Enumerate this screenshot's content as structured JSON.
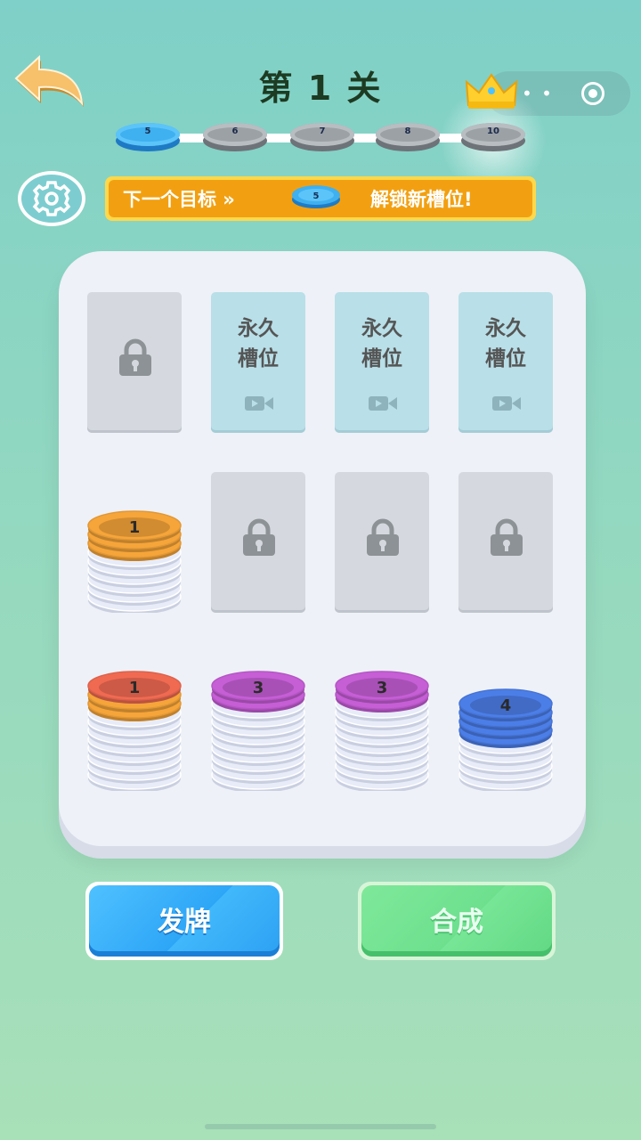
{
  "header": {
    "title": "第 1 关",
    "back_icon": "back-arrow-icon",
    "crown_icon": "crown-icon"
  },
  "progress": {
    "current": "5",
    "nodes": [
      "5",
      "6",
      "7",
      "8",
      "10"
    ]
  },
  "banner": {
    "prefix": "下一个目标 »",
    "coin_value": "5",
    "suffix": "解锁新槽位!"
  },
  "board": {
    "perm_slot_label_line1": "永久",
    "perm_slot_label_line2": "槽位",
    "rows": [
      [
        {
          "type": "locked"
        },
        {
          "type": "perm"
        },
        {
          "type": "perm"
        },
        {
          "type": "perm"
        }
      ],
      [
        {
          "type": "stack",
          "top_color": "#f6a53a",
          "top_count": 3,
          "label": "1",
          "empty_discs": 6
        },
        {
          "type": "locked"
        },
        {
          "type": "locked"
        },
        {
          "type": "locked"
        }
      ],
      [
        {
          "type": "stack",
          "top_color": "#f6a53a",
          "top_count": 2,
          "under_color": "#f06a52",
          "under_count": 1,
          "label": "1",
          "empty_discs": 8
        },
        {
          "type": "stack",
          "top_color": "#c65ed6",
          "top_count": 2,
          "label": "3",
          "empty_discs": 9
        },
        {
          "type": "stack",
          "top_color": "#c65ed6",
          "top_count": 2,
          "label": "3",
          "empty_discs": 9
        },
        {
          "type": "stack",
          "top_color": "#4c7ee8",
          "top_count": 4,
          "label": "4",
          "empty_discs": 5
        }
      ]
    ]
  },
  "buttons": {
    "deal": "发牌",
    "merge": "合成"
  },
  "colors": {
    "accent_blue": "#2ea6f7",
    "accent_green": "#6de08e",
    "banner_orange": "#f2a011"
  }
}
